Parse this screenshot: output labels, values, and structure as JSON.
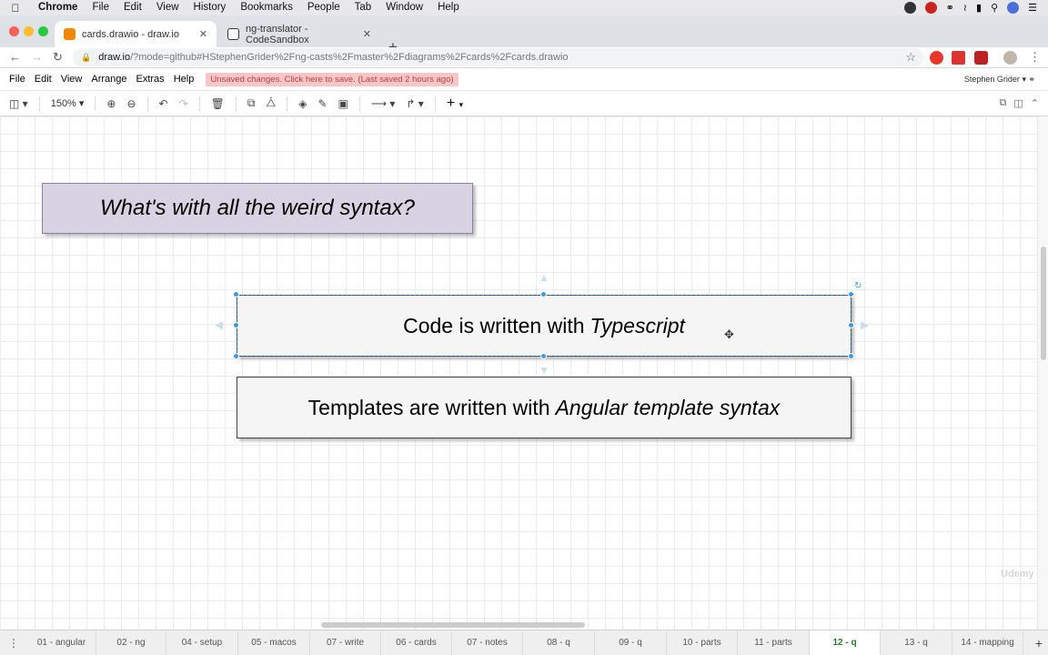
{
  "menubar": {
    "items": [
      "Chrome",
      "File",
      "Edit",
      "View",
      "History",
      "Bookmarks",
      "People",
      "Tab",
      "Window",
      "Help"
    ]
  },
  "browser": {
    "tabs": [
      {
        "title": "cards.drawio - draw.io",
        "active": true
      },
      {
        "title": "ng-translator - CodeSandbox",
        "active": false
      }
    ],
    "url_host": "draw.io",
    "url_path": "/?mode=github#HStephenGrider%2Fng-casts%2Fmaster%2Fdiagrams%2Fcards%2Fcards.drawio"
  },
  "app_menu": {
    "items": [
      "File",
      "Edit",
      "View",
      "Arrange",
      "Extras",
      "Help"
    ],
    "unsaved_notice": "Unsaved changes. Click here to save. (Last saved 2 hours ago)",
    "user": "Stephen Grider"
  },
  "toolbar": {
    "zoom": "150%"
  },
  "diagram": {
    "title": "What's with all the weird syntax?",
    "box_ts_text": "Code is written with",
    "box_ts_italic": "Typescript",
    "box_tpl_text": "Templates are written with",
    "box_tpl_italic": "Angular template syntax"
  },
  "page_tabs": [
    {
      "label": "01 - angular",
      "active": false
    },
    {
      "label": "02 - ng",
      "active": false
    },
    {
      "label": "04 - setup",
      "active": false
    },
    {
      "label": "05 - macos",
      "active": false
    },
    {
      "label": "07 - write",
      "active": false
    },
    {
      "label": "06 - cards",
      "active": false
    },
    {
      "label": "07 - notes",
      "active": false
    },
    {
      "label": "08 - q",
      "active": false
    },
    {
      "label": "09 - q",
      "active": false
    },
    {
      "label": "10 - parts",
      "active": false
    },
    {
      "label": "11 - parts",
      "active": false
    },
    {
      "label": "12 - q",
      "active": true
    },
    {
      "label": "13 - q",
      "active": false
    },
    {
      "label": "14 - mapping",
      "active": false
    }
  ],
  "watermark": "Udemy",
  "colors": {
    "title_fill": "#d9d2e2",
    "selection": "#3d9be0",
    "active_page_tab": "#2c7a2c"
  }
}
